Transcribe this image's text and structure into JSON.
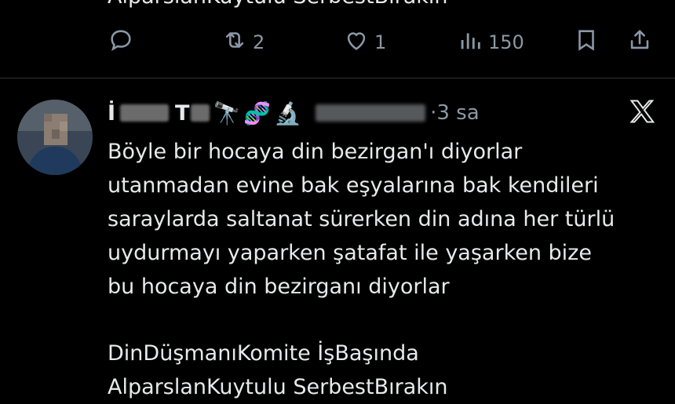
{
  "previous_tweet": {
    "text_fragment": "AlparslanKuytulu SerbestBırakın",
    "actions": {
      "reply_count": "",
      "retweet_count": "2",
      "like_count": "1",
      "view_count": "150"
    }
  },
  "tweet": {
    "author_name_visible_parts": [
      "İ",
      "T"
    ],
    "author_emojis": [
      "🔭",
      "🧬",
      "🔬"
    ],
    "time": "3 sa",
    "lines": [
      "Böyle bir hocaya din bezirgan'ı diyorlar",
      "utanmadan evine bak eşyalarına bak kendileri",
      "saraylarda saltanat sürerken din adına her türlü",
      "uydurmayı yaparken şatafat ile yaşarken bize",
      "bu hocaya din bezirganı diyorlar"
    ],
    "hashtags_lines": [
      "DinDüşmanıKomite İşBaşında",
      "AlparslanKuytulu SerbestBırakın"
    ],
    "platform_logo": "x-logo"
  },
  "icons": {
    "reply": "reply-icon",
    "retweet": "retweet-icon",
    "like": "heart-icon",
    "views": "views-icon",
    "bookmark": "bookmark-icon",
    "share": "share-icon"
  }
}
